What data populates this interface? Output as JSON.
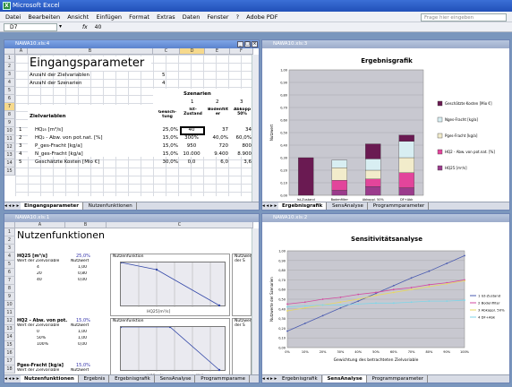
{
  "app": {
    "title": "Microsoft Excel",
    "icon": "excel-icon"
  },
  "menu": [
    "Datei",
    "Bearbeiten",
    "Ansicht",
    "Einfügen",
    "Format",
    "Extras",
    "Daten",
    "Fenster",
    "?",
    "Adobe PDF"
  ],
  "help_placeholder": "Frage hier eingeben",
  "formula": {
    "namebox": "D7",
    "value": "40"
  },
  "w1": {
    "title": "NAWA10.xls:4",
    "cols": [
      "A",
      "B",
      "C",
      "D",
      "E",
      "F"
    ],
    "rows": [
      "1",
      "2",
      "3",
      "4",
      "5",
      "6",
      "7",
      "8",
      "9",
      "10",
      "11",
      "12",
      "13",
      "14",
      "15"
    ],
    "heading": "Eingangsparameter",
    "anzahl_ziel": {
      "label": "Anzahl der Zielvariablen",
      "value": "5"
    },
    "anzahl_szen": {
      "label": "Anzahl der Szenarien",
      "value": "4"
    },
    "szen_head": "Szenarien",
    "zielvar_head": "Zielvariablen",
    "gew_head": "Gewich-\ntung",
    "scen_nums": [
      "1",
      "2",
      "3"
    ],
    "scen_names": [
      "Ist-\nZustand",
      "Bodenfilt\ner",
      "Abkopp\n50%"
    ],
    "table": [
      {
        "n": "1",
        "name": "HQ₂₅ [m³/s]",
        "w": "25,0%",
        "v": [
          "40",
          "37",
          "34"
        ]
      },
      {
        "n": "2",
        "name": "HQ₂ - Abw. von pot.nat. [%]",
        "w": "15,0%",
        "v": [
          "300%",
          "40,0%",
          "60,0%"
        ]
      },
      {
        "n": "3",
        "name": "P_ges-Fracht [kg/a]",
        "w": "15,0%",
        "v": [
          "950",
          "720",
          "800"
        ]
      },
      {
        "n": "4",
        "name": "N_ges-Fracht [kg/a]",
        "w": "15,0%",
        "v": [
          "10.000",
          "9.400",
          "8.900"
        ]
      },
      {
        "n": "5",
        "name": "Geschätzte Kosten [Mio €]",
        "w": "30,0%",
        "v": [
          "0,0",
          "6,0",
          "3,6"
        ]
      }
    ],
    "tabs": [
      "Eingangsparameter",
      "Nutzenfunktionen"
    ]
  },
  "w2": {
    "title": "NAWA10.xls:3",
    "chart_data": {
      "type": "bar",
      "title": "Ergebnisgrafik",
      "xlabel": "Szenario",
      "ylabel": "Nutzwert",
      "categories": [
        "Ist-Zustand",
        "Bodenfilter",
        "Abkoppl. 50%",
        "DF+Abk"
      ],
      "ylim": [
        0,
        1
      ],
      "series": [
        {
          "name": "HQ25 [m³/s]",
          "color": "#9b3b8c",
          "values": [
            0.0,
            0.04,
            0.07,
            0.06
          ]
        },
        {
          "name": "HQ2 - Abw. von pot.nat. [%]",
          "color": "#e2459b",
          "values": [
            0.0,
            0.08,
            0.06,
            0.12
          ]
        },
        {
          "name": "Pges-Fracht [kg/a]",
          "color": "#f2eccb",
          "values": [
            0.0,
            0.1,
            0.07,
            0.12
          ]
        },
        {
          "name": "Nges-Fracht [kg/a]",
          "color": "#d8eef2",
          "values": [
            0.0,
            0.06,
            0.09,
            0.13
          ]
        },
        {
          "name": "Geschätzte Kosten [Mio €]",
          "color": "#6a1a52",
          "values": [
            0.3,
            0.0,
            0.12,
            0.05
          ]
        }
      ],
      "yticks": [
        "0,00",
        "0,10",
        "0,20",
        "0,30",
        "0,40",
        "0,50",
        "0,60",
        "0,70",
        "0,80",
        "0,90",
        "1,00"
      ],
      "legend": [
        "Geschätzte Kosten [Mio €]",
        "Nges-Fracht [kg/a]",
        "Pges-Fracht [kg/a]",
        "HQ2 - Abw. von pot.nat. [%]",
        "HQ25 [m³/s]"
      ]
    },
    "tabs": [
      "Ergebnisgrafik",
      "SensAnalyse",
      "Programmparameter"
    ]
  },
  "w3": {
    "title": "NAWA10.xls:1",
    "heading": "Nutzenfunktionen",
    "block1": {
      "name": "HQ25 [m³/s]",
      "w": "25,0%",
      "l1": "Wert der Zielvariable",
      "l2": "Nutzwert",
      "rows": [
        [
          "4",
          "1,00"
        ],
        [
          "20",
          "0,80"
        ],
        [
          "40",
          "0,00"
        ]
      ]
    },
    "block2": {
      "name": "HQ2 - Abw. von pot.",
      "w": "15,0%",
      "l1": "Wert der Zielvariable",
      "l2": "Nutzwert",
      "rows": [
        [
          "0",
          "1,00"
        ],
        [
          "50%",
          "1,00"
        ],
        [
          "100%",
          "0,00"
        ]
      ]
    },
    "block3": {
      "name": "Pges-Fracht [kg/a]",
      "w": "15,0%",
      "l1": "Wert der Zielvariable",
      "l2": "Nutzwert"
    },
    "mini_title": "Nutzenfunktion",
    "mini_title2": "Nutzwerte der S",
    "mini_legend1": "HQ25[m³/s]",
    "mini_legend2": "HQ2 - Abw. von pot.nat. [%]",
    "tabs": [
      "Nutzenfunktionen",
      "Ergebnis",
      "Ergebnisgrafik",
      "SensAnalyse",
      "Programmparame"
    ]
  },
  "w4": {
    "title": "NAWA10.xls:2",
    "chart_data": {
      "type": "line",
      "title": "Sensitivitätsanalyse",
      "xlabel": "Gewichtung des betrachteten Zielvariable",
      "ylabel": "Nutzwerte der Szenarien",
      "x": [
        "0%",
        "10%",
        "20%",
        "30%",
        "40%",
        "50%",
        "60%",
        "70%",
        "80%",
        "90%",
        "100%"
      ],
      "ylim": [
        0,
        1
      ],
      "series": [
        {
          "name": "1 Ist-Zustand",
          "color": "#4a5bb0",
          "values": [
            0.17,
            0.25,
            0.33,
            0.41,
            0.48,
            0.56,
            0.64,
            0.72,
            0.79,
            0.87,
            0.95
          ]
        },
        {
          "name": "2 Bodenfilter",
          "color": "#d24aa0",
          "values": [
            0.45,
            0.47,
            0.5,
            0.52,
            0.55,
            0.57,
            0.6,
            0.62,
            0.65,
            0.67,
            0.7
          ]
        },
        {
          "name": "3 Abkoppl. 50%",
          "color": "#e8d860",
          "values": [
            0.38,
            0.41,
            0.44,
            0.47,
            0.5,
            0.54,
            0.57,
            0.6,
            0.63,
            0.66,
            0.69
          ]
        },
        {
          "name": "4 DF+Abk",
          "color": "#7fd6e8",
          "values": [
            0.42,
            0.43,
            0.44,
            0.44,
            0.45,
            0.46,
            0.46,
            0.47,
            0.48,
            0.48,
            0.49
          ]
        }
      ],
      "yticks": [
        "0,00",
        "0,10",
        "0,20",
        "0,30",
        "0,40",
        "0,50",
        "0,60",
        "0,70",
        "0,80",
        "0,90",
        "1,00"
      ]
    },
    "tabs": [
      "Ergebnisgrafik",
      "SensAnalyse",
      "Programmparameter"
    ]
  }
}
